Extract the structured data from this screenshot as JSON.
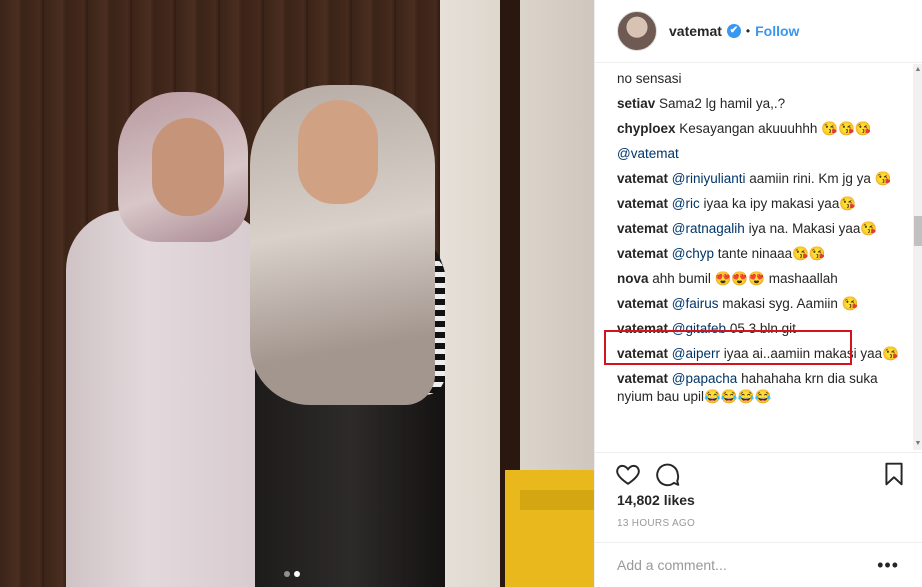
{
  "post": {
    "username": "vatemat",
    "verified_mark": "✔",
    "separator": "•",
    "follow_label": "Follow"
  },
  "comments": [
    {
      "user": "",
      "mention": "",
      "text": "no sensasi"
    },
    {
      "user": "setiav",
      "mention": "",
      "text": "Sama2 lg hamil ya,.?"
    },
    {
      "user": "chyploex",
      "mention": "",
      "text": "Kesayangan akuuuhhh 😘😘😘"
    },
    {
      "user": "",
      "mention": "@vatemat",
      "text": ""
    },
    {
      "user": "vatemat",
      "mention": "@riniyulianti",
      "text": "aamiin rini. Km jg ya 😘"
    },
    {
      "user": "vatemat",
      "mention": "@ric",
      "text": "iyaa ka ipy makasi yaa😘"
    },
    {
      "user": "vatemat",
      "mention": "@ratnagalih",
      "text": "iya na. Makasi yaa😘"
    },
    {
      "user": "vatemat",
      "mention": "@chyp",
      "text": "tante ninaaa😘😘"
    },
    {
      "user": "nova",
      "mention": "",
      "text": "ahh bumil 😍😍😍 mashaallah"
    },
    {
      "user": "vatemat",
      "mention": "@fairus",
      "text": "makasi syg. Aamiin 😘"
    },
    {
      "user": "vatemat",
      "mention": "@gitafeb",
      "text": "05 3 bln git"
    },
    {
      "user": "vatemat",
      "mention": "@aiperr",
      "text": "iyaa ai..aamiin makasi yaa😘"
    },
    {
      "user": "vatemat",
      "mention": "@papacha",
      "text": "hahahaha krn dia suka nyium bau upil😂😂😂😂"
    }
  ],
  "likes": "14,802 likes",
  "timestamp": "13 HOURS AGO",
  "add_comment_placeholder": "Add a comment...",
  "more_label": "•••",
  "icons": [
    "heart-icon",
    "comment-icon",
    "bookmark-icon",
    "avatar"
  ],
  "colors": {
    "accent": "#3897f0",
    "highlight": "#d0151d",
    "mention": "#003569"
  },
  "carousel": {
    "total": 2,
    "active": 2
  }
}
